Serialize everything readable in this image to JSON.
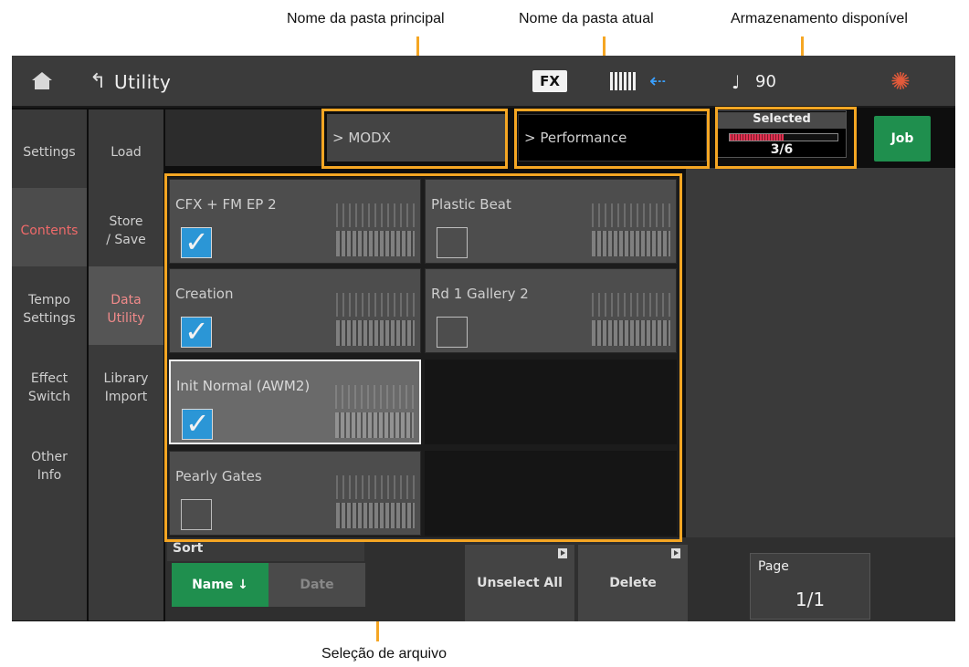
{
  "annotations": {
    "parent_folder": "Nome da pasta principal",
    "current_folder": "Nome da pasta atual",
    "storage": "Armazenamento disponível",
    "file_selection": "Seleção de arquivo"
  },
  "colors": {
    "annotation_line": "#f5a623",
    "accent_green": "#1f8f4e",
    "checkbox_blue": "#2b96d6",
    "active_red": "#f06a6a"
  },
  "topbar": {
    "title": "Utility",
    "fx_label": "FX",
    "tempo_value": "90",
    "icons": [
      "home-icon",
      "back-arrow-icon",
      "keyboard-icon",
      "usb-icon",
      "note-icon",
      "grid-icon",
      "gear-icon"
    ]
  },
  "left_tabs": [
    {
      "label": "Settings"
    },
    {
      "label": "Contents",
      "active": true
    },
    {
      "label": "Tempo\nSettings"
    },
    {
      "label": "Effect\nSwitch"
    },
    {
      "label": "Other\nInfo"
    },
    {
      "label": ""
    }
  ],
  "sub_tabs": [
    {
      "label": "Load"
    },
    {
      "label": "Store\n/ Save"
    },
    {
      "label": "Data\nUtility",
      "active": true
    },
    {
      "label": "Library\nImport"
    },
    {
      "label": ""
    },
    {
      "label": ""
    }
  ],
  "header": {
    "parent_folder": "MODX",
    "current_folder": "Performance",
    "storage_label": "Selected",
    "storage_count": "3/6",
    "storage_fraction": 0.5,
    "job_label": "Job"
  },
  "files": [
    {
      "name": "CFX + FM EP 2",
      "checked": true
    },
    {
      "name": "Plastic Beat",
      "checked": false
    },
    {
      "name": "Creation",
      "checked": true
    },
    {
      "name": "Rd 1 Gallery 2",
      "checked": false
    },
    {
      "name": "Init Normal (AWM2)",
      "checked": true,
      "highlighted": true
    },
    {
      "name": "Pearly Gates",
      "checked": false
    }
  ],
  "bottom": {
    "sort_label": "Sort",
    "sort_name": "Name ↓",
    "sort_date": "Date",
    "unselect_all": "Unselect All",
    "delete": "Delete",
    "page_label": "Page",
    "page_value": "1/1"
  }
}
